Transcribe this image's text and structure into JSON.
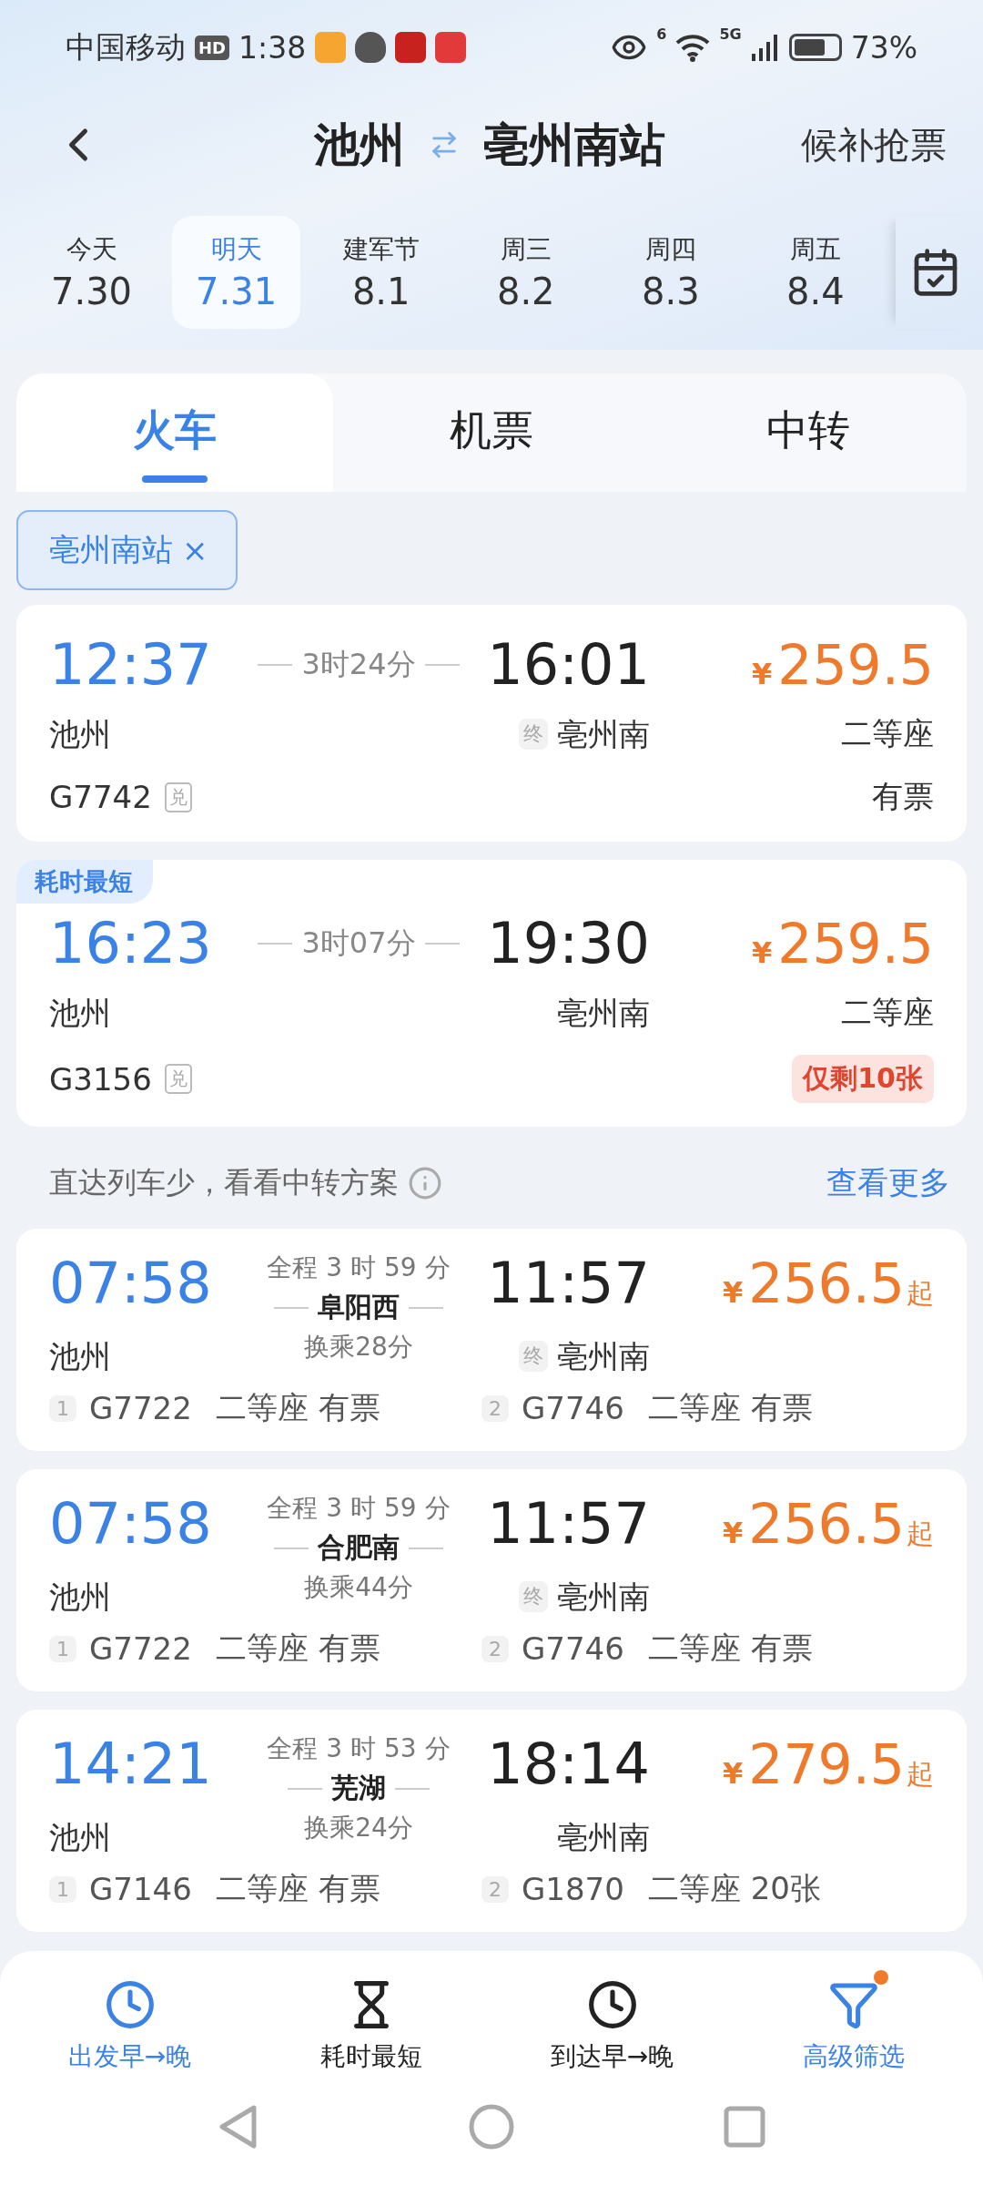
{
  "status_bar": {
    "carrier": "中国移动",
    "hd": "HD",
    "time": "1:38",
    "wifi_label": "6",
    "network": "5G",
    "battery": "73%"
  },
  "header": {
    "from": "池州",
    "to": "亳州南站",
    "action": "候补抢票"
  },
  "dates": [
    {
      "weekday": "今天",
      "date": "7.30",
      "selected": false
    },
    {
      "weekday": "明天",
      "date": "7.31",
      "selected": true
    },
    {
      "weekday": "建军节",
      "date": "8.1",
      "selected": false
    },
    {
      "weekday": "周三",
      "date": "8.2",
      "selected": false
    },
    {
      "weekday": "周四",
      "date": "8.3",
      "selected": false
    },
    {
      "weekday": "周五",
      "date": "8.4",
      "selected": false
    }
  ],
  "tabs": [
    {
      "label": "火车",
      "selected": true
    },
    {
      "label": "机票",
      "selected": false
    },
    {
      "label": "中转",
      "selected": false
    }
  ],
  "filter_chips": [
    {
      "label": "亳州南站",
      "remove": "×"
    }
  ],
  "direct_trains": [
    {
      "depart_time": "12:37",
      "depart_station": "池州",
      "duration": "3时24分",
      "arrive_time": "16:01",
      "terminal_mark": "终",
      "arrive_station": "亳州南",
      "currency": "¥",
      "price": "259.5",
      "seat": "二等座",
      "train_no": "G7742",
      "redeem_mark": "兑",
      "availability": "有票",
      "low_stock": false
    },
    {
      "badge": "耗时最短",
      "depart_time": "16:23",
      "depart_station": "池州",
      "duration": "3时07分",
      "arrive_time": "19:30",
      "arrive_station": "亳州南",
      "currency": "¥",
      "price": "259.5",
      "seat": "二等座",
      "train_no": "G3156",
      "redeem_mark": "兑",
      "availability": "仅剩10张",
      "low_stock": true
    }
  ],
  "transfer_hint": {
    "text": "直达列车少，看看中转方案",
    "link": "查看更多"
  },
  "transfer_trains": [
    {
      "depart_time": "07:58",
      "depart_station": "池州",
      "total": "全程 3 时 59 分",
      "via": "阜阳西",
      "wait": "换乘28分",
      "arrive_time": "11:57",
      "terminal_mark": "终",
      "arrive_station": "亳州南",
      "currency": "¥",
      "price": "256.5",
      "price_suffix": "起",
      "legs": [
        {
          "index": "1",
          "train_no": "G7722",
          "seat": "二等座",
          "availability": "有票"
        },
        {
          "index": "2",
          "train_no": "G7746",
          "seat": "二等座",
          "availability": "有票"
        }
      ]
    },
    {
      "depart_time": "07:58",
      "depart_station": "池州",
      "total": "全程 3 时 59 分",
      "via": "合肥南",
      "wait": "换乘44分",
      "arrive_time": "11:57",
      "terminal_mark": "终",
      "arrive_station": "亳州南",
      "currency": "¥",
      "price": "256.5",
      "price_suffix": "起",
      "legs": [
        {
          "index": "1",
          "train_no": "G7722",
          "seat": "二等座",
          "availability": "有票"
        },
        {
          "index": "2",
          "train_no": "G7746",
          "seat": "二等座",
          "availability": "有票"
        }
      ]
    },
    {
      "depart_time": "14:21",
      "depart_station": "池州",
      "total": "全程 3 时 53 分",
      "via": "芜湖",
      "wait": "换乘24分",
      "arrive_time": "18:14",
      "arrive_station": "亳州南",
      "currency": "¥",
      "price": "279.5",
      "price_suffix": "起",
      "legs": [
        {
          "index": "1",
          "train_no": "G7146",
          "seat": "二等座",
          "availability": "有票"
        },
        {
          "index": "2",
          "train_no": "G1870",
          "seat": "二等座",
          "availability": "20张"
        }
      ]
    }
  ],
  "sort_bar": [
    {
      "kind": "depart",
      "label": "出发早→晚",
      "active": true,
      "dot": false
    },
    {
      "kind": "duration",
      "label": "耗时最短",
      "active": false,
      "dot": false
    },
    {
      "kind": "arrive",
      "label": "到达早→晚",
      "active": false,
      "dot": false
    },
    {
      "kind": "filter",
      "label": "高级筛选",
      "active": true,
      "dot": true
    }
  ]
}
